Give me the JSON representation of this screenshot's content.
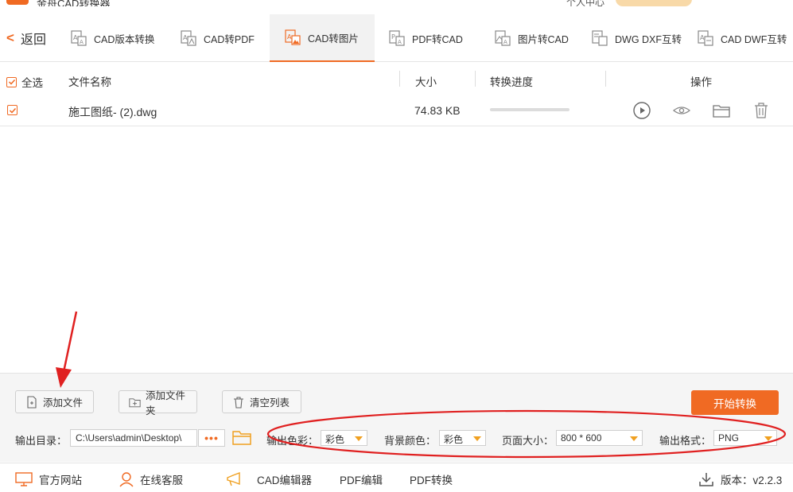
{
  "window": {
    "title": "金舟CAD转换器",
    "right_text": "个人中心"
  },
  "toolbar": {
    "back_label": "返回",
    "tabs": [
      {
        "label": "CAD版本转换",
        "icon": "cad-version-icon",
        "active": false
      },
      {
        "label": "CAD转PDF",
        "icon": "cad-to-pdf-icon",
        "active": false
      },
      {
        "label": "CAD转图片",
        "icon": "cad-to-image-icon",
        "active": true
      },
      {
        "label": "PDF转CAD",
        "icon": "pdf-to-cad-icon",
        "active": false
      },
      {
        "label": "图片转CAD",
        "icon": "image-to-cad-icon",
        "active": false
      },
      {
        "label": "DWG DXF互转",
        "icon": "dwg-dxf-icon",
        "active": false
      },
      {
        "label": "CAD DWF互转",
        "icon": "cad-dwf-icon",
        "active": false
      }
    ]
  },
  "table": {
    "headers": {
      "select_all": "全选",
      "name": "文件名称",
      "size": "大小",
      "progress": "转换进度",
      "actions": "操作"
    },
    "rows": [
      {
        "checked": true,
        "name": "施工图纸- (2).dwg",
        "size": "74.83 KB",
        "progress": 0
      }
    ]
  },
  "bottom": {
    "add_file": "添加文件",
    "add_folder": "添加文件夹",
    "clear_list": "清空列表",
    "start": "开始转换",
    "output_dir_label": "输出目录：",
    "output_dir_value": "C:\\Users\\admin\\Desktop\\",
    "dots": "•••",
    "color_label": "输出色彩：",
    "color_value": "彩色",
    "bg_label": "背景颜色：",
    "bg_value": "彩色",
    "page_label": "页面大小：",
    "page_value": "800 * 600",
    "format_label": "输出格式：",
    "format_value": "PNG"
  },
  "status": {
    "website": "官方网站",
    "service": "在线客服",
    "cad_editor": "CAD编辑器",
    "pdf_editor": "PDF编辑",
    "pdf_convert": "PDF转换",
    "version": "版本：v2.2.3"
  },
  "colors": {
    "accent": "#f06a23",
    "annotation": "#e02020"
  }
}
